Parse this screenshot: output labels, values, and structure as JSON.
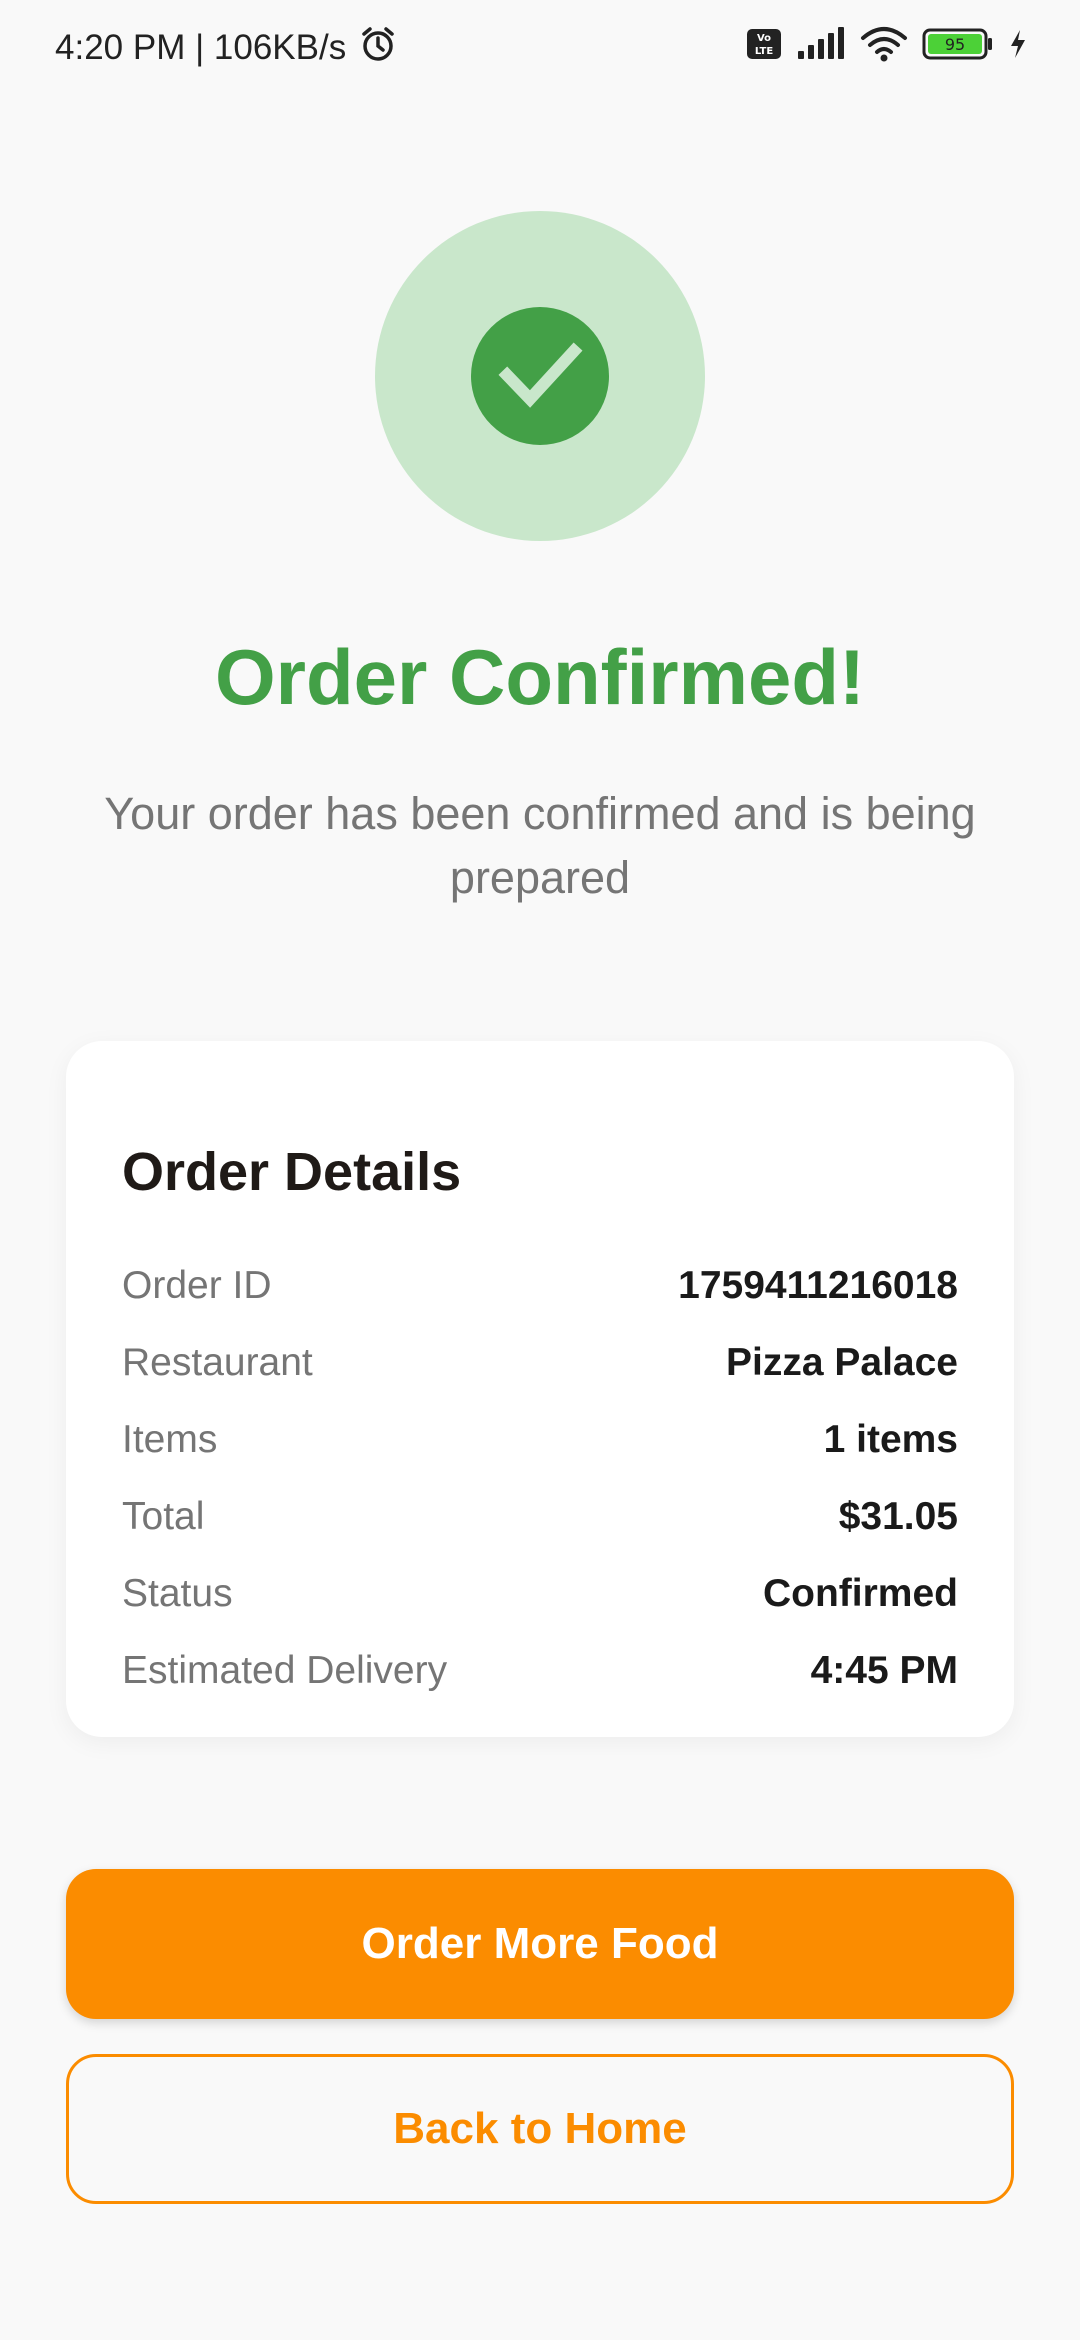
{
  "status_bar": {
    "time_speed": "4:20 PM | 106KB/s",
    "battery": "95",
    "icons": [
      "alarm-icon",
      "volte-icon",
      "signal-icon",
      "wifi-icon",
      "battery-icon",
      "charging-icon"
    ]
  },
  "success": {
    "icon": "check-icon",
    "title": "Order Confirmed!",
    "subtitle": "Your order has been confirmed and is being prepared"
  },
  "order_details": {
    "title": "Order Details",
    "rows": [
      {
        "label": "Order ID",
        "value": "1759411216018"
      },
      {
        "label": "Restaurant",
        "value": "Pizza Palace"
      },
      {
        "label": "Items",
        "value": "1 items"
      },
      {
        "label": "Total",
        "value": "$31.05"
      },
      {
        "label": "Status",
        "value": "Confirmed"
      },
      {
        "label": "Estimated Delivery",
        "value": "4:45 PM"
      }
    ]
  },
  "actions": {
    "primary_label": "Order More Food",
    "secondary_label": "Back to Home"
  },
  "colors": {
    "accent": "#fb8c00",
    "success": "#43a047",
    "success_light": "#c9e7cb",
    "background": "#f9f9f9"
  }
}
